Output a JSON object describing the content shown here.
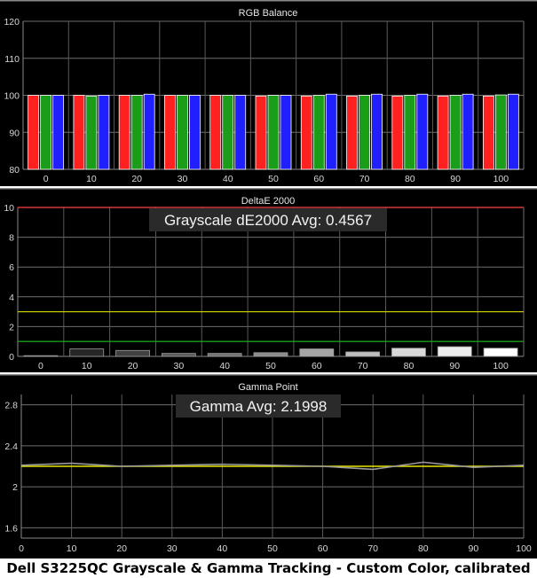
{
  "caption": "Dell S3225QC Grayscale & Gamma Tracking - Custom Color, calibrated",
  "chart_data": [
    {
      "type": "bar",
      "title": "RGB Balance",
      "categories": [
        "0",
        "10",
        "20",
        "30",
        "40",
        "50",
        "60",
        "70",
        "80",
        "90",
        "100"
      ],
      "ylim": [
        80,
        120
      ],
      "yticks": [
        80,
        90,
        100,
        110,
        120
      ],
      "grid": true,
      "series": [
        {
          "values": [
            100,
            100,
            100,
            100,
            100,
            99.8,
            99.8,
            99.8,
            99.8,
            99.8,
            99.8
          ],
          "color": "#ff2020"
        },
        {
          "values": [
            100,
            99.8,
            100,
            100,
            100,
            100,
            100,
            100,
            100,
            100,
            100.1
          ],
          "color": "#1a9e1a"
        },
        {
          "values": [
            100,
            100,
            100.3,
            100,
            100,
            100,
            100.3,
            100.3,
            100.3,
            100.3,
            100.3
          ],
          "color": "#2020ff"
        }
      ]
    },
    {
      "type": "bar",
      "title": "DeltaE 2000",
      "annotation": "Grayscale dE2000 Avg: 0.4567",
      "categories": [
        "0",
        "10",
        "20",
        "30",
        "40",
        "50",
        "60",
        "70",
        "80",
        "90",
        "100"
      ],
      "values": [
        0.05,
        0.5,
        0.4,
        0.2,
        0.2,
        0.25,
        0.5,
        0.3,
        0.55,
        0.65,
        0.55
      ],
      "bar_colors": [
        "#1a1a1a",
        "#262626",
        "#404040",
        "#595959",
        "#737373",
        "#8c8c8c",
        "#a6a6a6",
        "#bfbfbf",
        "#d9d9d9",
        "#ececec",
        "#ffffff"
      ],
      "ylim": [
        0,
        10
      ],
      "yticks": [
        0,
        2,
        4,
        6,
        8,
        10
      ],
      "reference_lines": [
        {
          "y": 10,
          "color": "#ff4040"
        },
        {
          "y": 3,
          "color": "#c8c800"
        },
        {
          "y": 1,
          "color": "#1a9e1a"
        }
      ],
      "grid": true
    },
    {
      "type": "line",
      "title": "Gamma Point",
      "annotation": "Gamma Avg: 2.1998",
      "x": [
        0,
        10,
        20,
        30,
        40,
        50,
        60,
        70,
        80,
        90,
        100
      ],
      "series": [
        {
          "values": [
            2.2,
            2.2,
            2.2,
            2.2,
            2.2,
            2.2,
            2.2,
            2.2,
            2.2,
            2.2,
            2.2
          ],
          "color": "#e8e800"
        },
        {
          "values": [
            2.21,
            2.23,
            2.2,
            2.21,
            2.22,
            2.21,
            2.2,
            2.17,
            2.24,
            2.19,
            2.21
          ],
          "color": "#9a9a9a"
        }
      ],
      "xlim": [
        0,
        100
      ],
      "xticks": [
        0,
        10,
        20,
        30,
        40,
        50,
        60,
        70,
        80,
        90,
        100
      ],
      "ylim": [
        1.5,
        2.9
      ],
      "yticks": [
        1.6,
        2,
        2.4,
        2.8
      ],
      "grid": true
    }
  ]
}
